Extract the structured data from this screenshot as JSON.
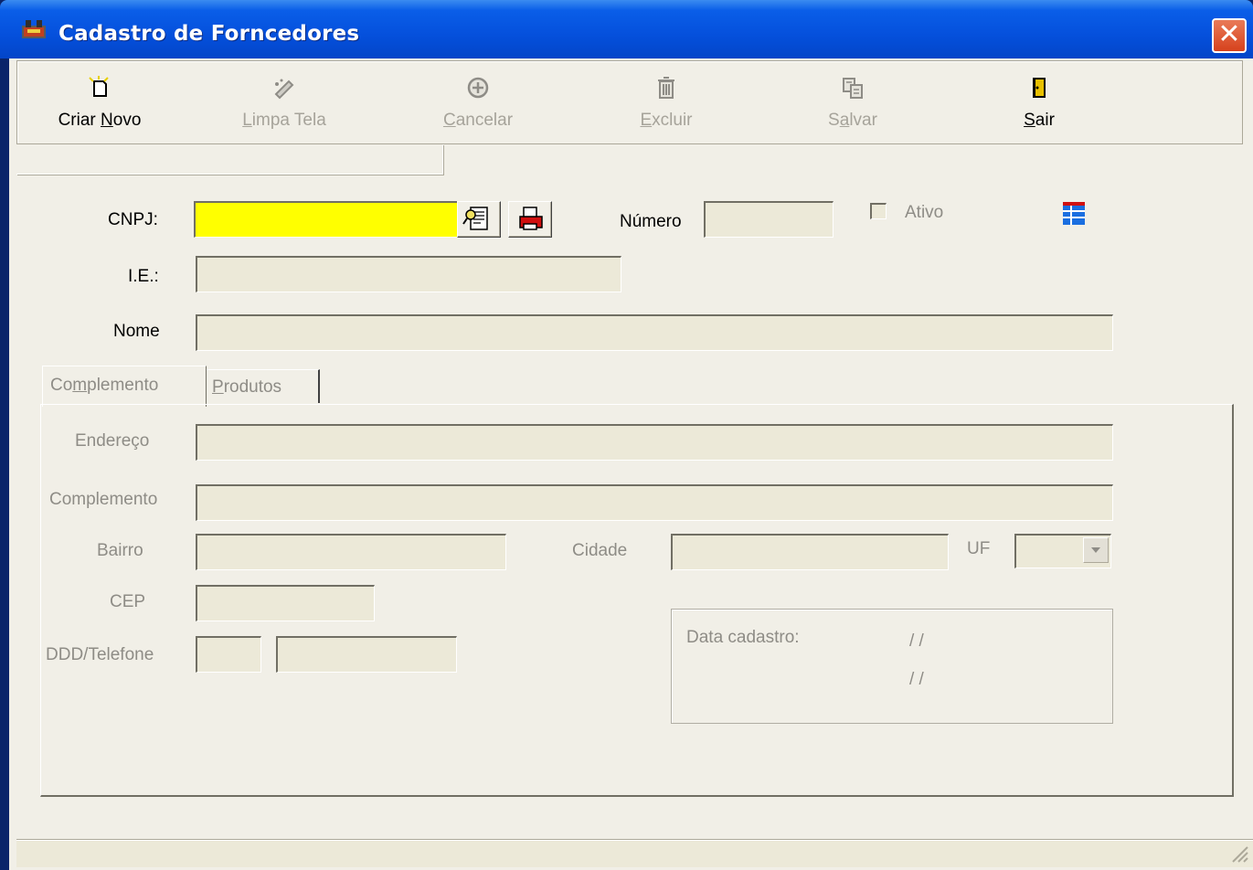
{
  "window": {
    "title": "Cadastro de Forncedores",
    "close_glyph": "✕"
  },
  "toolbar": {
    "buttons": [
      {
        "pre": "Criar ",
        "key": "N",
        "post": "ovo",
        "enabled": true,
        "icon": "new-document-icon"
      },
      {
        "pre": "",
        "key": "L",
        "post": "impa Tela",
        "enabled": false,
        "icon": "eraser-icon"
      },
      {
        "pre": "",
        "key": "C",
        "post": "ancelar",
        "enabled": false,
        "icon": "cancel-icon"
      },
      {
        "pre": "",
        "key": "E",
        "post": "xcluir",
        "enabled": false,
        "icon": "trash-icon"
      },
      {
        "pre": "S",
        "key": "a",
        "post": "lvar",
        "enabled": false,
        "icon": "save-icon"
      },
      {
        "pre": "",
        "key": "S",
        "post": "air",
        "enabled": true,
        "icon": "exit-door-icon"
      }
    ]
  },
  "form": {
    "cnpj_label": "CNPJ:",
    "cnpj_value": "",
    "numero_label": "Número",
    "numero_value": "",
    "ativo_label": "Ativo",
    "ie_label": "I.E.:",
    "ie_value": "",
    "nome_label": "Nome",
    "nome_value": ""
  },
  "tabs": {
    "complemento": {
      "pre": "Co",
      "key": "m",
      "post": "plemento"
    },
    "produtos": {
      "pre": "",
      "key": "P",
      "post": "rodutos"
    }
  },
  "complemento": {
    "endereco_label": "Endereço",
    "complemento_label": "Complemento",
    "bairro_label": "Bairro",
    "cidade_label": "Cidade",
    "uf_label": "UF",
    "cep_label": "CEP",
    "ddd_label": "DDD/Telefone",
    "data_cadastro_label": "Data cadastro:",
    "date1": "/ /",
    "date2": "/ /"
  },
  "colors": {
    "cnpj_bg": "#ffff00",
    "titlebar": "#0550dc",
    "close": "#d6411c"
  }
}
